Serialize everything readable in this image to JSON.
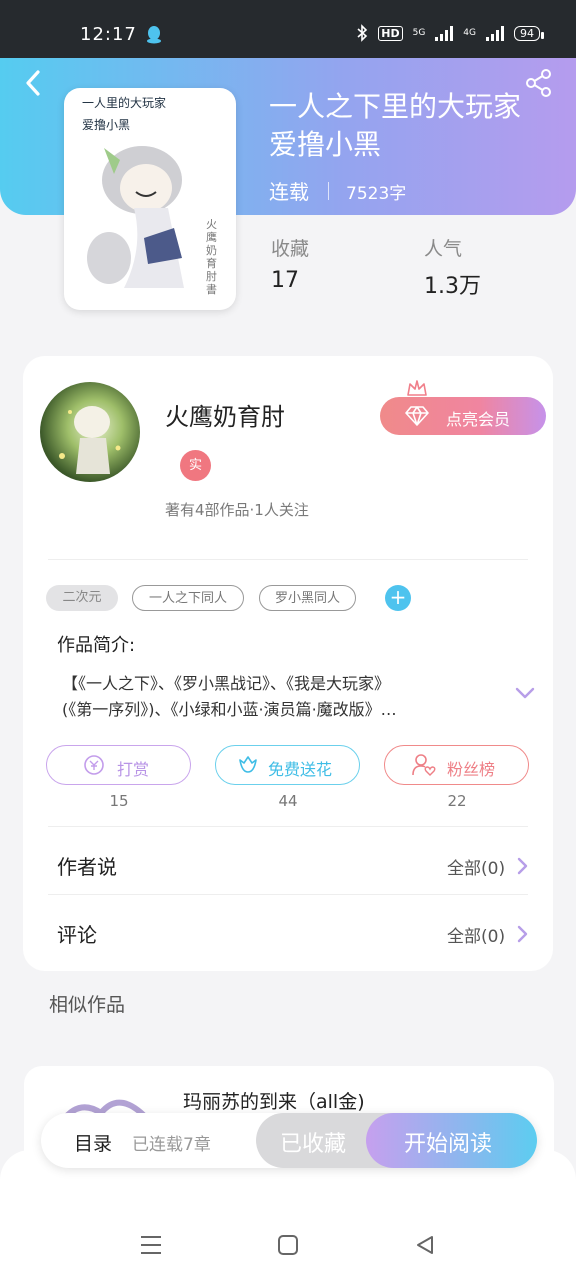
{
  "status_bar": {
    "time": "12:17",
    "hd": "HD",
    "net1": "5G",
    "net2": "4G",
    "battery": "94"
  },
  "book": {
    "title": "一人之下里的大玩家爱撸小黑",
    "status": "连载",
    "words": "7523字",
    "cover_line1": "一人里的大玩家",
    "cover_line2": "爱撸小黑",
    "cover_vertical": "火鹰奶育肘書"
  },
  "stats": {
    "collect_label": "收藏",
    "collect_value": "17",
    "popularity_label": "人气",
    "popularity_value": "1.3万"
  },
  "author": {
    "name": "火鹰奶育肘",
    "badge": "实",
    "meta": "著有4部作品·1人关注",
    "vip_label": "点亮会员"
  },
  "tags": [
    "二次元",
    "一人之下同人",
    "罗小黑同人"
  ],
  "intro": {
    "title": "作品简介:",
    "line1": "【《一人之下》、《罗小黑战记》、《我是大玩家》",
    "line2": "(《第一序列》)、《小绿和小蓝·演员篇·魔改版》…"
  },
  "actions": [
    {
      "label": "打赏",
      "count": "15"
    },
    {
      "label": "免费送花",
      "count": "44"
    },
    {
      "label": "粉丝榜",
      "count": "22"
    }
  ],
  "rows": {
    "author_says": {
      "title": "作者说",
      "right": "全部(0)"
    },
    "comments": {
      "title": "评论",
      "right": "全部(0)"
    }
  },
  "similar": {
    "title": "相似作品",
    "item_title": "玛丽苏的到来（all金)"
  },
  "bottom": {
    "toc": "目录",
    "toc_count": "已连载7章",
    "collected": "已收藏",
    "read": "开始阅读"
  },
  "colors": {
    "accent_blue": "#4ec3ee",
    "accent_purple": "#b59cee",
    "vip_pink": "#f08a8a"
  }
}
